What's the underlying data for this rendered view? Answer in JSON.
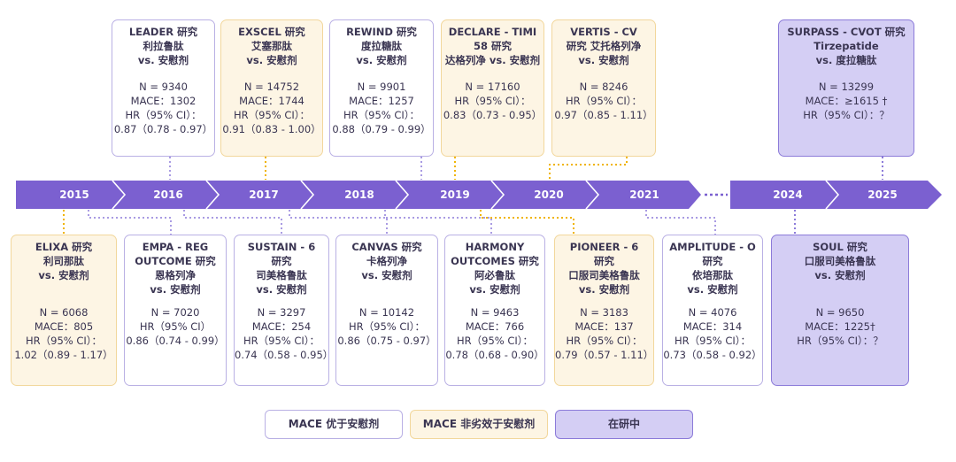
{
  "timeline": {
    "years": [
      "2015",
      "2016",
      "2017",
      "2018",
      "2019",
      "2020",
      "2021",
      "2024",
      "2025"
    ],
    "colors": {
      "axis": "#7b60d0",
      "connector_purple": "#a99be3",
      "connector_yellow": "#f0b400"
    }
  },
  "top_cards": [
    {
      "head": [
        "LEADER 研究",
        "利拉鲁肽",
        "vs. 安慰剂"
      ],
      "body": [
        "N = 9340",
        "MACE：1302",
        "HR（95% CI）：",
        "0.87（0.78 - 0.97）"
      ],
      "status": "superior"
    },
    {
      "head": [
        "EXSCEL 研究",
        "艾塞那肽",
        "vs. 安慰剂"
      ],
      "body": [
        "N = 14752",
        "MACE：1744",
        "HR（95% CI）：",
        "0.91（0.83 - 1.00）"
      ],
      "status": "noninferior"
    },
    {
      "head": [
        "REWIND 研究",
        "度拉糖肽",
        "vs. 安慰剂"
      ],
      "body": [
        "N = 9901",
        "MACE：1257",
        "HR（95% CI）：",
        "0.88（0.79 - 0.99）"
      ],
      "status": "superior"
    },
    {
      "head": [
        "DECLARE - TIMI",
        "58 研究",
        "达格列净 vs. 安慰剂"
      ],
      "body": [
        "N = 17160",
        "HR（95% CI）：",
        "0.83（0.73 - 0.95）"
      ],
      "status": "noninferior"
    },
    {
      "head": [
        "VERTIS - CV",
        "研究 艾托格列净",
        "vs. 安慰剂"
      ],
      "body": [
        "N = 8246",
        "HR（95% CI）：",
        "0.97（0.85 - 1.11）"
      ],
      "status": "noninferior"
    },
    {
      "head": [
        "SURPASS - CVOT 研究",
        "Tirzepatide",
        "vs. 度拉糖肽"
      ],
      "body": [
        "N = 13299",
        "MACE：≥1615 †",
        "HR（95% CI）：？"
      ],
      "status": "ongoing"
    }
  ],
  "bottom_cards": [
    {
      "head": [
        "ELIXA 研究",
        "利司那肽",
        "vs. 安慰剂"
      ],
      "body": [
        "N = 6068",
        "MACE：805",
        "HR（95% CI）：",
        "1.02（0.89 - 1.17）"
      ],
      "status": "noninferior"
    },
    {
      "head": [
        "EMPA - REG",
        "OUTCOME 研究",
        "恩格列净",
        "vs. 安慰剂"
      ],
      "body": [
        "N = 7020",
        "HR（95% CI）",
        "0.86（0.74 - 0.99）"
      ],
      "status": "superior"
    },
    {
      "head": [
        "SUSTAIN - 6",
        "研究",
        "司美格鲁肽",
        "vs. 安慰剂"
      ],
      "body": [
        "N = 3297",
        "MACE：254",
        "HR（95% CI）：",
        "0.74（0.58 - 0.95）"
      ],
      "status": "superior"
    },
    {
      "head": [
        "CANVAS 研究",
        "卡格列净",
        "vs. 安慰剂"
      ],
      "body": [
        "N = 10142",
        "HR（95% CI）：",
        "0.86（0.75 - 0.97）"
      ],
      "status": "superior"
    },
    {
      "head": [
        "HARMONY",
        "OUTCOMES 研究",
        "阿必鲁肽",
        "vs. 安慰剂"
      ],
      "body": [
        "N = 9463",
        "MACE：766",
        "HR（95% CI）：",
        "0.78（0.68 - 0.90）"
      ],
      "status": "superior"
    },
    {
      "head": [
        "PIONEER - 6",
        "研究",
        "口服司美格鲁肽",
        "vs. 安慰剂"
      ],
      "body": [
        "N = 3183",
        "MACE：137",
        "HR（95% CI）：",
        "0.79（0.57 - 1.11）"
      ],
      "status": "noninferior"
    },
    {
      "head": [
        "AMPLITUDE - O",
        "研究",
        "依培那肽",
        "vs. 安慰剂"
      ],
      "body": [
        "N = 4076",
        "MACE：314",
        "HR（95% CI）：",
        "0.73（0.58 - 0.92）"
      ],
      "status": "superior"
    },
    {
      "head": [
        "SOUL 研究",
        "口服司美格鲁肽",
        "vs. 安慰剂"
      ],
      "body": [
        "N = 9650",
        "MACE：1225†",
        "HR（95% CI）：？"
      ],
      "status": "ongoing"
    }
  ],
  "legend": {
    "superior": "MACE 优于安慰剂",
    "noninferior": "MACE 非劣效于安慰剂",
    "ongoing": "在研中"
  }
}
